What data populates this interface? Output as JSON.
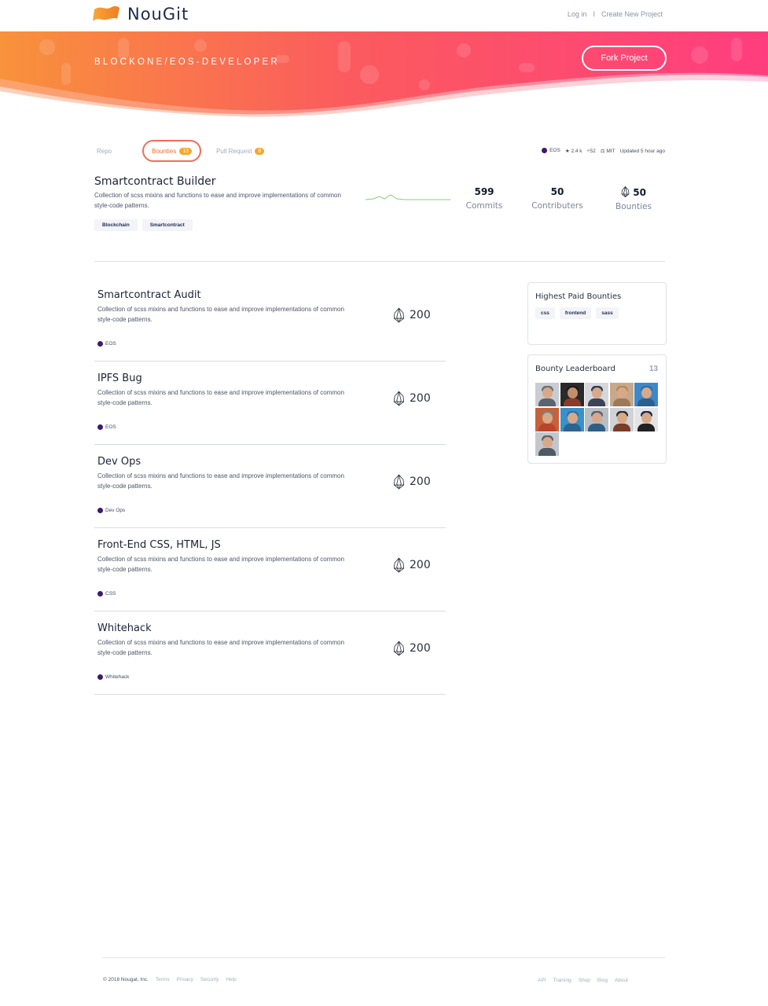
{
  "app": {
    "name": "NouGit"
  },
  "topnav": {
    "login": "Log in",
    "separator": "I",
    "create": "Create New Project"
  },
  "hero": {
    "title": "BLOCKONE/EOS-DEVELOPER",
    "fork_label": "Fork Project"
  },
  "tabs": [
    {
      "label": "Repo"
    },
    {
      "label": "Bounties",
      "count": "13"
    },
    {
      "label": "Pull Request",
      "count": "8"
    }
  ],
  "meta": {
    "language": "EOS",
    "stars": "2.4 k",
    "forks": "52",
    "license": "MIT",
    "updated": "Updated 5 hour ago"
  },
  "repo": {
    "title": "Smartcontract Builder",
    "description": "Collection of scss mixins and functions to ease and improve implementations of common style-code patterns.",
    "tags": [
      "Blockchain",
      "Smartcontract"
    ],
    "stats": [
      {
        "value": "599",
        "label": "Commits"
      },
      {
        "value": "50",
        "label": "Contributers"
      },
      {
        "value": "50",
        "label": "Bounties"
      }
    ]
  },
  "bounties": [
    {
      "title": "Smartcontract Audit",
      "description": "Collection of scss mixins and functions to ease and improve implementations of common style-code patterns.",
      "amount": "200",
      "tag": "EOS"
    },
    {
      "title": "IPFS Bug",
      "description": "Collection of scss mixins and functions to ease and improve implementations of common style-code patterns.",
      "amount": "200",
      "tag": "EOS"
    },
    {
      "title": "Dev Ops",
      "description": "Collection of scss mixins and functions to ease and improve implementations of common style-code patterns.",
      "amount": "200",
      "tag": "Dev Ops"
    },
    {
      "title": "Front-End CSS, HTML, JS",
      "description": "Collection of scss mixins and functions to ease and improve implementations of common style-code patterns.",
      "amount": "200",
      "tag": "CSS"
    },
    {
      "title": "Whitehack",
      "description": "Collection of scss mixins and functions to ease and improve implementations of common style-code patterns.",
      "amount": "200",
      "tag": "Whitehack"
    }
  ],
  "sidebar": {
    "highest_paid": {
      "title": "Highest Paid Bounties",
      "chips": [
        "css",
        "frontend",
        "sass"
      ]
    },
    "leaderboard": {
      "title": "Bounty Leaderboard",
      "count": "13",
      "avatars": 11
    }
  },
  "footer": {
    "copyright": "© 2018 Nougat, Inc.",
    "left_links": [
      "Terms",
      "Privacy",
      "Security",
      "Help"
    ],
    "right_links": [
      "API",
      "Training",
      "Shop",
      "Blog",
      "About"
    ]
  },
  "colors": {
    "hero_start": "#f8923b",
    "hero_end": "#ff3d7f",
    "accent": "#f26c2f",
    "badge": "#f5a72c",
    "language_dot": "#3d1a6e"
  }
}
